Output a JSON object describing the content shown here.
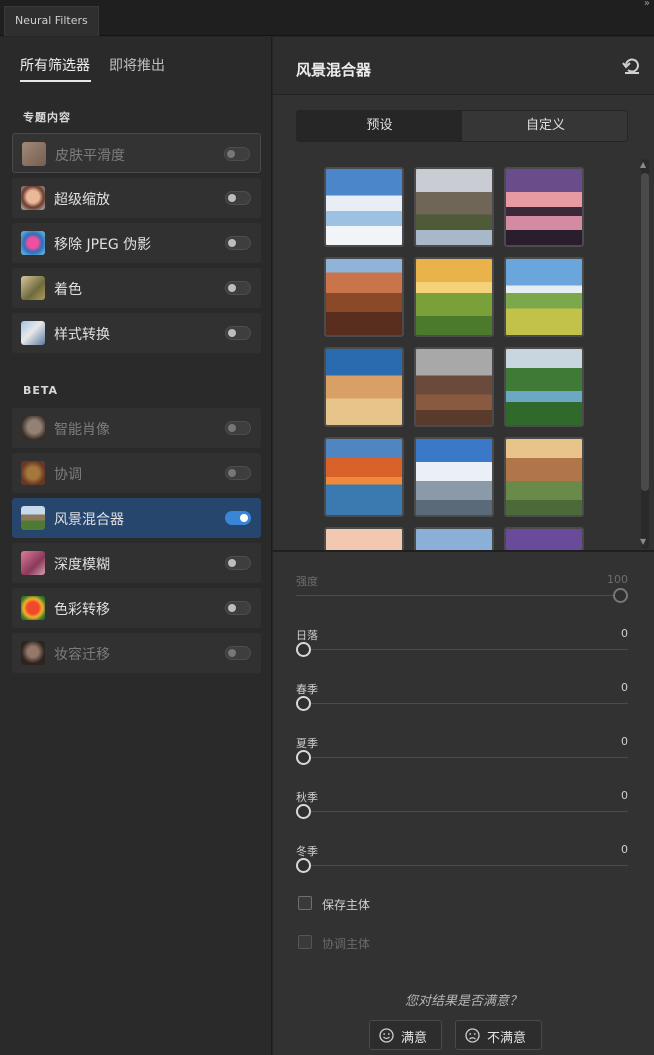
{
  "window": {
    "tab_title": "Neural Filters",
    "collapse_glyph": "»"
  },
  "left": {
    "tabs": [
      "所有筛选器",
      "即将推出"
    ],
    "sections": {
      "featured": "专题内容",
      "beta": "BETA"
    },
    "featured_items": [
      {
        "label": "皮肤平滑度",
        "enabled": false,
        "available": false,
        "icon": "skin-smoothing-icon"
      },
      {
        "label": "超级缩放",
        "enabled": false,
        "available": true,
        "icon": "super-zoom-icon"
      },
      {
        "label": "移除 JPEG 伪影",
        "enabled": false,
        "available": true,
        "icon": "jpeg-artifacts-icon"
      },
      {
        "label": "着色",
        "enabled": false,
        "available": true,
        "icon": "colorize-icon"
      },
      {
        "label": "样式转换",
        "enabled": false,
        "available": true,
        "icon": "style-transfer-icon"
      }
    ],
    "beta_items": [
      {
        "label": "智能肖像",
        "enabled": false,
        "available": false,
        "icon": "smart-portrait-icon"
      },
      {
        "label": "协调",
        "enabled": false,
        "available": false,
        "icon": "harmonization-icon"
      },
      {
        "label": "风景混合器",
        "enabled": true,
        "available": true,
        "icon": "landscape-mixer-icon"
      },
      {
        "label": "深度模糊",
        "enabled": false,
        "available": true,
        "icon": "depth-blur-icon"
      },
      {
        "label": "色彩转移",
        "enabled": false,
        "available": true,
        "icon": "color-transfer-icon"
      },
      {
        "label": "妆容迁移",
        "enabled": false,
        "available": false,
        "icon": "makeup-transfer-icon"
      }
    ]
  },
  "right": {
    "title": "风景混合器",
    "segments": [
      "预设",
      "自定义"
    ],
    "active_segment": "预设",
    "presets_count_visible": 15,
    "sliders": [
      {
        "label": "强度",
        "value": 100,
        "enabled": false
      },
      {
        "label": "日落",
        "value": 0,
        "enabled": true
      },
      {
        "label": "春季",
        "value": 0,
        "enabled": true
      },
      {
        "label": "夏季",
        "value": 0,
        "enabled": true
      },
      {
        "label": "秋季",
        "value": 0,
        "enabled": true
      },
      {
        "label": "冬季",
        "value": 0,
        "enabled": true
      }
    ],
    "checkboxes": [
      {
        "label": "保存主体",
        "checked": false,
        "enabled": true
      },
      {
        "label": "协调主体",
        "checked": false,
        "enabled": false
      }
    ],
    "feedback": {
      "question": "您对结果是否满意？",
      "satisfied": "满意",
      "unsatisfied": "不满意"
    }
  },
  "colors": {
    "accent": "#3b85d8",
    "selected_row": "#26466d",
    "panel": "#323232"
  }
}
